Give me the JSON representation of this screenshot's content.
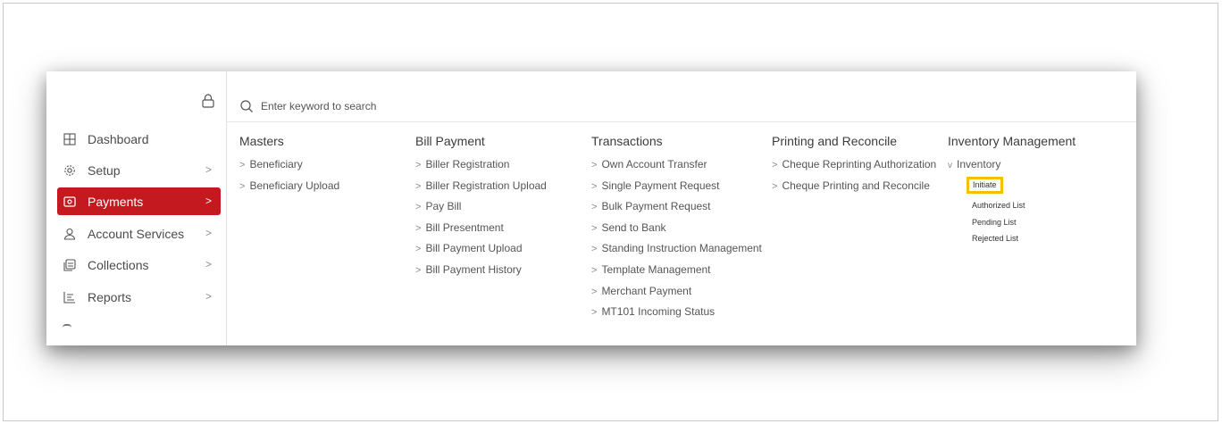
{
  "sidebar": {
    "items": [
      {
        "label": "Dashboard",
        "icon": "grid-icon",
        "chevron": false
      },
      {
        "label": "Setup",
        "icon": "gear-icon",
        "chevron": true
      },
      {
        "label": "Payments",
        "icon": "wallet-icon",
        "chevron": true,
        "active": true
      },
      {
        "label": "Account Services",
        "icon": "user-icon",
        "chevron": true
      },
      {
        "label": "Collections",
        "icon": "stack-icon",
        "chevron": true
      },
      {
        "label": "Reports",
        "icon": "report-icon",
        "chevron": true
      }
    ],
    "chevron_glyph": ">",
    "active_color": "#c4191f"
  },
  "search": {
    "placeholder": "Enter keyword to search"
  },
  "menu": {
    "masters": {
      "title": "Masters",
      "links": [
        "Beneficiary",
        "Beneficiary Upload"
      ]
    },
    "bill_payment": {
      "title": "Bill Payment",
      "links": [
        "Biller Registration",
        "Biller Registration Upload",
        "Pay Bill",
        "Bill Presentment",
        "Bill Payment Upload",
        "Bill Payment History"
      ]
    },
    "transactions": {
      "title": "Transactions",
      "links": [
        "Own Account Transfer",
        "Single Payment Request",
        "Bulk Payment Request",
        "Send to Bank",
        "Standing Instruction Management",
        "Template Management",
        "Merchant Payment",
        "MT101 Incoming Status"
      ]
    },
    "printing": {
      "title": "Printing and Reconcile",
      "links": [
        "Cheque Reprinting Authorization",
        "Cheque Printing and Reconcile"
      ]
    },
    "inventory": {
      "title": "Inventory Management",
      "sub": "Inventory",
      "items": [
        "Initiate",
        "Authorized List",
        "Pending List",
        "Rejected List"
      ],
      "highlight_color": "#f2c200"
    }
  },
  "glyphs": {
    "link_prefix": ">",
    "expanded_prefix": "v"
  }
}
